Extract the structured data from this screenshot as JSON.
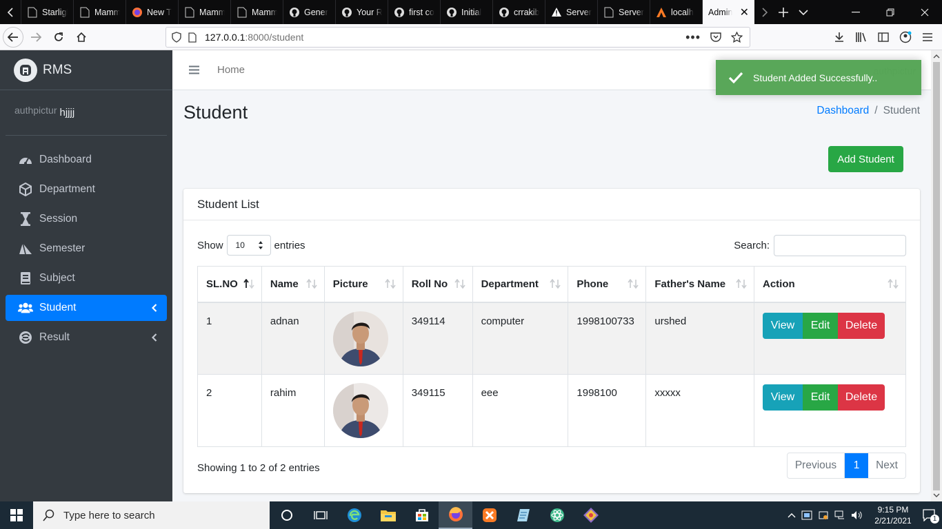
{
  "browser": {
    "tabs": [
      {
        "label": "Starlight R",
        "favicon": "page-icon"
      },
      {
        "label": "Mamma's",
        "favicon": "page-icon"
      },
      {
        "label": "New T",
        "favicon": "firefox-icon"
      },
      {
        "label": "Mamma's",
        "favicon": "page-icon"
      },
      {
        "label": "Mamma's",
        "favicon": "page-icon"
      },
      {
        "label": "Gener",
        "favicon": "github-icon"
      },
      {
        "label": "Your R",
        "favicon": "github-icon"
      },
      {
        "label": "first co",
        "favicon": "github-icon"
      },
      {
        "label": "Initial",
        "favicon": "github-icon"
      },
      {
        "label": "crrakib",
        "favicon": "github-icon"
      },
      {
        "label": "Server",
        "favicon": "warning-icon"
      },
      {
        "label": "Server Erro",
        "favicon": "page-icon"
      },
      {
        "label": "localh",
        "favicon": "xampp-icon"
      }
    ],
    "active_tab": "Admin",
    "url_host": "127.0.0.1",
    "url_rest": ":8000/student"
  },
  "sidebar": {
    "brand": "RMS",
    "user_image_alt": "authpictur",
    "user_name": "hjjjj",
    "items": [
      {
        "label": "Dashboard",
        "icon": "dashboard-icon"
      },
      {
        "label": "Department",
        "icon": "department-icon"
      },
      {
        "label": "Session",
        "icon": "hourglass-icon"
      },
      {
        "label": "Semester",
        "icon": "semester-icon"
      },
      {
        "label": "Subject",
        "icon": "book-icon"
      },
      {
        "label": "Student",
        "icon": "users-icon",
        "active": true
      },
      {
        "label": "Result",
        "icon": "result-icon"
      }
    ]
  },
  "header": {
    "home_link": "Home",
    "user_image_alt": "authpictur"
  },
  "page": {
    "title": "Student",
    "breadcrumb": {
      "link": "Dashboard",
      "separator": "/",
      "current": "Student"
    },
    "add_button": "Add Student"
  },
  "toast": {
    "message": "Student Added Successfully.."
  },
  "card": {
    "title": "Student List",
    "show_label": "Show",
    "entries_value": "10",
    "entries_label": "entries",
    "search_label": "Search:",
    "search_value": "",
    "columns": [
      "SL.NO",
      "Name",
      "Picture",
      "Roll No",
      "Department",
      "Phone",
      "Father's Name",
      "Action"
    ],
    "rows": [
      {
        "sl": "1",
        "name": "adnan",
        "roll": "349114",
        "department": "computer",
        "phone": "1998100733",
        "father": "urshed"
      },
      {
        "sl": "2",
        "name": "rahim",
        "roll": "349115",
        "department": "eee",
        "phone": "1998100",
        "father": "xxxxx"
      }
    ],
    "actions": {
      "view": "View",
      "edit": "Edit",
      "delete": "Delete"
    },
    "info": "Showing 1 to 2 of 2 entries",
    "pager": {
      "previous": "Previous",
      "page": "1",
      "next": "Next"
    }
  },
  "taskbar": {
    "search_placeholder": "Type here to search",
    "time": "9:15 PM",
    "date": "2/21/2021",
    "notification_count": "1"
  },
  "colors": {
    "sidebar_bg": "#343a40",
    "primary": "#007bff",
    "success": "#28a745",
    "info": "#17a2b8",
    "danger": "#dc3545",
    "toast_bg": "#51a351"
  }
}
